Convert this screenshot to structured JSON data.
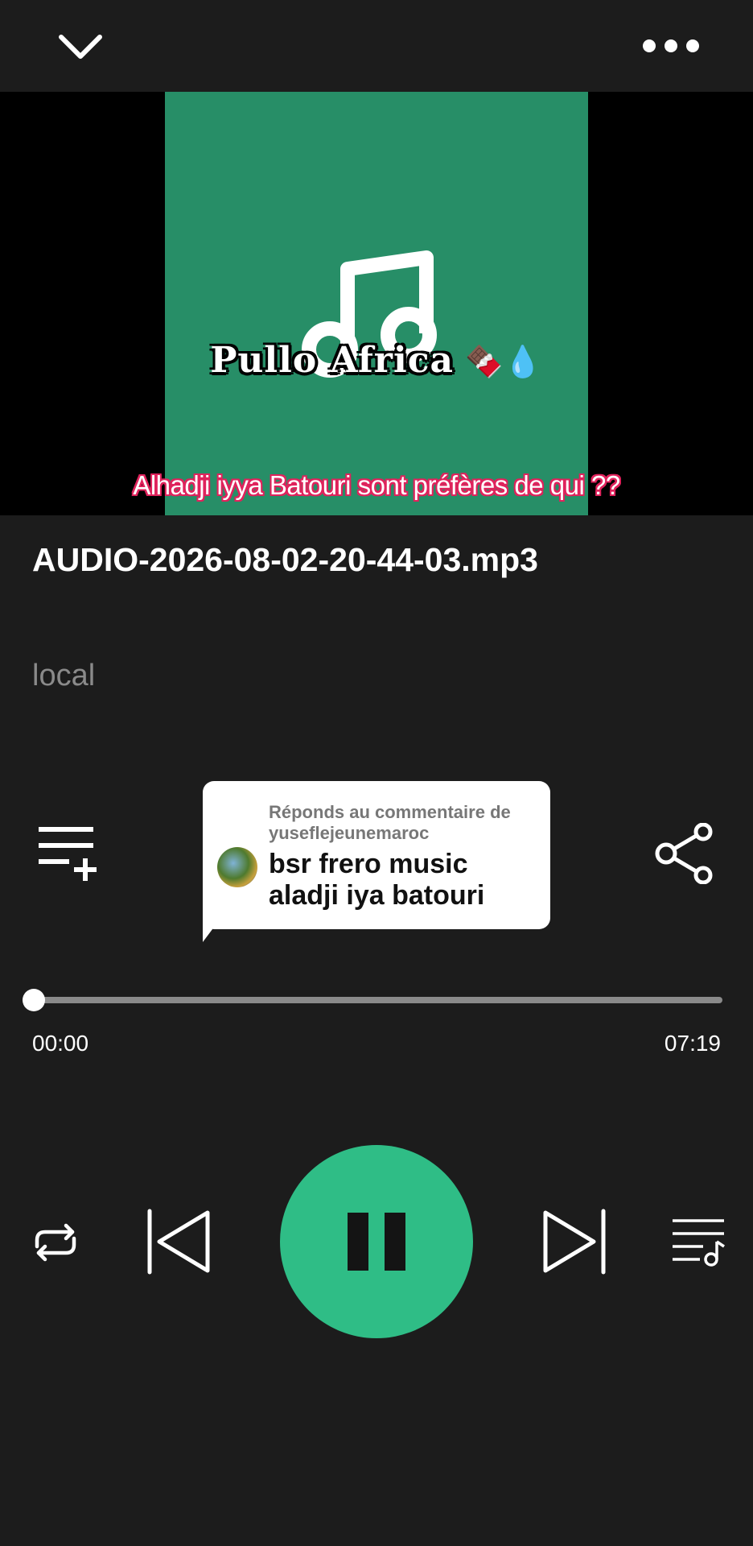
{
  "header": {
    "back_icon": "chevron-down-icon",
    "more_icon": "more-horizontal-icon"
  },
  "video": {
    "cover_title": "Pullo Africa",
    "cover_emoji": "🍫💧",
    "cover_color": "#278e67",
    "caption": "Alhadji iyya Batouri sont préfères de qui ??"
  },
  "track": {
    "title": "AUDIO-2026-08-02-20-44-03.mp3",
    "artist": "local"
  },
  "comment": {
    "header": "Réponds au commentaire de yuseflejeunemaroc",
    "text": "bsr frero music aladji iya batouri"
  },
  "progress": {
    "elapsed": "00:00",
    "total": "07:19",
    "fraction": 0.0
  },
  "controls": {
    "repeat_icon": "repeat-icon",
    "prev_icon": "skip-previous-icon",
    "pause_icon": "pause-icon",
    "next_icon": "skip-next-icon",
    "queue_icon": "queue-music-icon",
    "add_playlist_icon": "playlist-add-icon",
    "share_icon": "share-icon",
    "accent_color": "#2fbd86"
  }
}
